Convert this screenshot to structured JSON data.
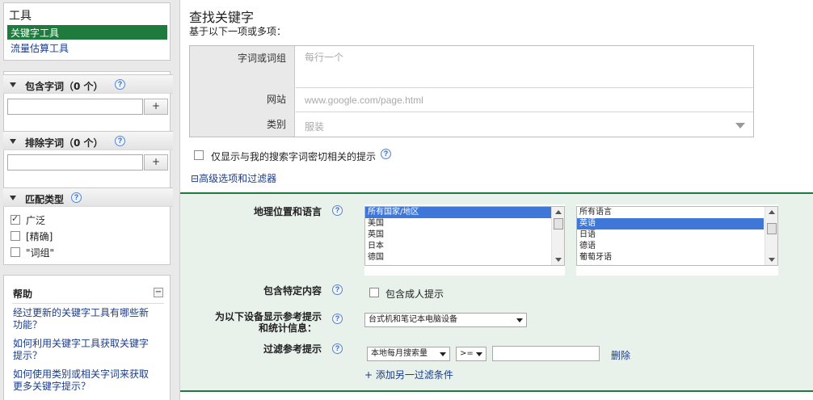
{
  "sidebar": {
    "tools_title": "工具",
    "tools": [
      {
        "label": "关键字工具",
        "selected": true
      },
      {
        "label": "流量估算工具",
        "selected": false
      }
    ],
    "include": {
      "title": "包含字词（0 个）",
      "add": "+"
    },
    "exclude": {
      "title": "排除字词（0 个）",
      "add": "+"
    },
    "match": {
      "title": "匹配类型",
      "options": [
        {
          "label": "广泛",
          "checked": true
        },
        {
          "label": "[精确]",
          "checked": false
        },
        {
          "label": "\"词组\"",
          "checked": false
        }
      ]
    },
    "help": {
      "title": "帮助",
      "collapse": "−",
      "links": [
        "经过更新的关键字工具有哪些新功能？",
        "如何利用关键字工具获取关键字提示？",
        "如何使用类别或相关字词来获取更多关键字提示？"
      ]
    },
    "help_icon": "?"
  },
  "main": {
    "title": "查找关键字",
    "subtitle": "基于以下一项或多项：",
    "form": {
      "words_label": "字词或词组",
      "words_placeholder": "每行一个",
      "site_label": "网站",
      "site_placeholder": "www.google.com/page.html",
      "category_label": "类别",
      "category_placeholder": "服装"
    },
    "only_related": "仅显示与我的搜索字词密切相关的提示",
    "advanced": "高级选项和过滤器",
    "advanced_icon": "⊟"
  },
  "advanced": {
    "geo_label": "地理位置和语言",
    "countries": [
      "所有国家/地区",
      "美国",
      "英国",
      "日本",
      "德国"
    ],
    "countries_selected": 0,
    "languages": [
      "所有语言",
      "英语",
      "日语",
      "德语",
      "葡萄牙语"
    ],
    "languages_selected": 1,
    "content_label": "包含特定内容",
    "adult_label": "包含成人提示",
    "device_label_1": "为以下设备显示参考提示",
    "device_label_2": "和统计信息：",
    "device_value": "台式机和笔记本电脑设备",
    "filter_label": "过滤参考提示",
    "filter_metric": "本地每月搜索量",
    "filter_op": ">=",
    "filter_value": "",
    "delete": "删除",
    "add_filter": "+ 添加另一过滤条件"
  },
  "colors": {
    "selected_green": "#1f7a3d",
    "advanced_bg": "#e8f1ea",
    "advanced_border": "#1f7a3d",
    "link_blue": "#1a3c8a"
  }
}
